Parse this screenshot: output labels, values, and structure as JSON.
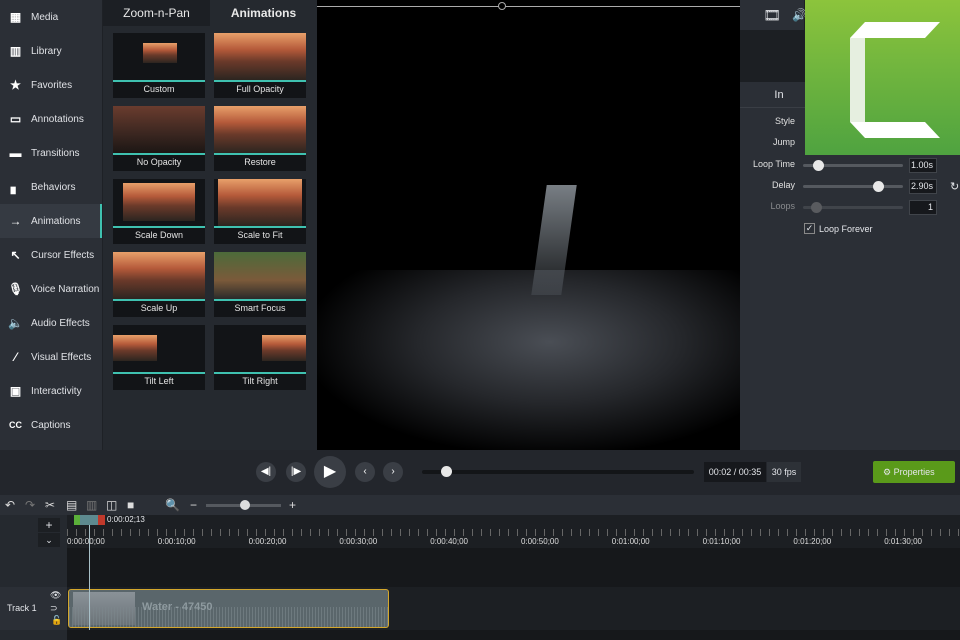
{
  "sidebar": {
    "items": [
      {
        "label": "Media",
        "icon": "film-icon"
      },
      {
        "label": "Library",
        "icon": "books-icon"
      },
      {
        "label": "Favorites",
        "icon": "star-icon"
      },
      {
        "label": "Annotations",
        "icon": "annotation-icon"
      },
      {
        "label": "Transitions",
        "icon": "transition-icon"
      },
      {
        "label": "Behaviors",
        "icon": "behaviors-icon"
      },
      {
        "label": "Animations",
        "icon": "animation-icon"
      },
      {
        "label": "Cursor Effects",
        "icon": "cursor-icon"
      },
      {
        "label": "Voice Narration",
        "icon": "microphone-icon"
      },
      {
        "label": "Audio Effects",
        "icon": "speaker-icon"
      },
      {
        "label": "Visual Effects",
        "icon": "wand-icon"
      },
      {
        "label": "Interactivity",
        "icon": "interactivity-icon"
      },
      {
        "label": "Captions",
        "icon": "cc-icon"
      }
    ]
  },
  "panel": {
    "tabs": [
      "Zoom-n-Pan",
      "Animations"
    ],
    "thumbs": [
      "Custom",
      "Full Opacity",
      "No Opacity",
      "Restore",
      "Scale Down",
      "Scale to Fit",
      "Scale Up",
      "Smart Focus",
      "Tilt Left",
      "Tilt Right"
    ]
  },
  "properties": {
    "tab": "In",
    "style_label": "Style",
    "jump_label": "Jump",
    "loop_time_label": "Loop Time",
    "loop_time_value": "1.00s",
    "loop_time_fraction": 0.1,
    "delay_label": "Delay",
    "delay_value": "2.90s",
    "delay_fraction": 0.7,
    "loops_label": "Loops",
    "loops_value": "1",
    "loop_forever_label": "Loop Forever",
    "loop_forever_checked": true
  },
  "playback": {
    "time": "00:02 / 00:35",
    "fps": "30 fps",
    "progress": 0.06,
    "properties_label": "Properties"
  },
  "timeline": {
    "playhead": "0:00:02;13",
    "ticks": [
      "0:00:00;00",
      "0:00:10;00",
      "0:00:20;00",
      "0:00:30;00",
      "0:00:40;00",
      "0:00:50;00",
      "0:01:00;00",
      "0:01:10;00",
      "0:01:20;00",
      "0:01:30;00"
    ],
    "track_label": "Track 1",
    "clip_label": "Water - 47450"
  },
  "colors": {
    "accent": "#3fc1b0",
    "properties_btn": "#5a9a1a",
    "logo": "#6db33f"
  }
}
